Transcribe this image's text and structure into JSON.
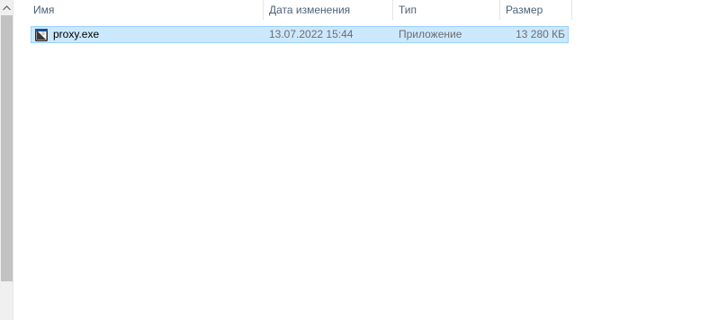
{
  "columns": {
    "name": "Имя",
    "date": "Дата изменения",
    "type": "Тип",
    "size": "Размер"
  },
  "files": [
    {
      "name": "proxy.exe",
      "date": "13.07.2022 15:44",
      "type": "Приложение",
      "size": "13 280 КБ",
      "icon": "exe-app-icon",
      "selected": true
    }
  ],
  "colors": {
    "selection_bg": "#cce8ff",
    "selection_border": "#99d1ff",
    "header_text": "#4c607a",
    "detail_text": "#6d6d6d"
  }
}
